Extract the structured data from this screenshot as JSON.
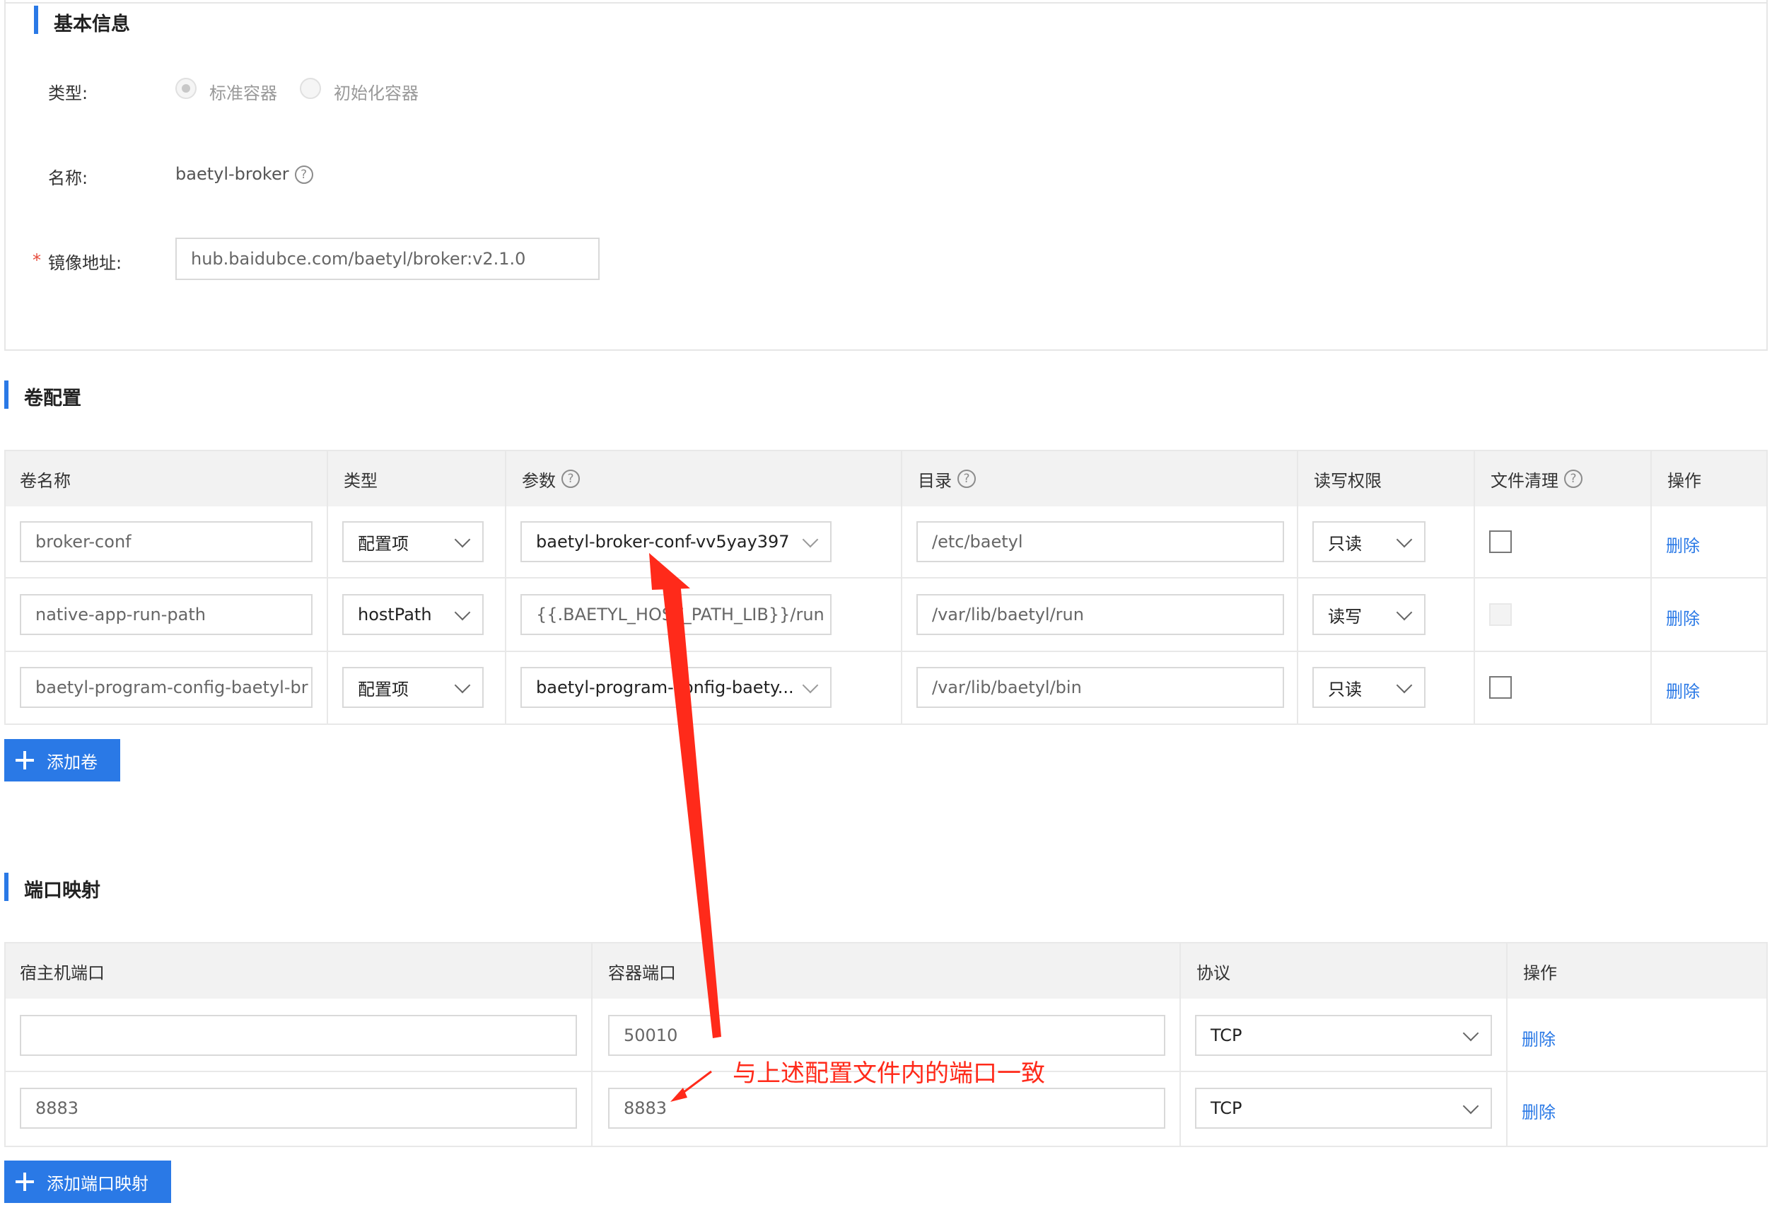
{
  "basic_info": {
    "title": "基本信息",
    "type_label": "类型:",
    "type_options": [
      "标准容器",
      "初始化容器"
    ],
    "name_label": "名称:",
    "name_value": "baetyl-broker",
    "image_label": "镜像地址:",
    "required_mark": "*",
    "image_value": "hub.baidubce.com/baetyl/broker:v2.1.0"
  },
  "volume_config": {
    "title": "卷配置",
    "columns": [
      "卷名称",
      "类型",
      "参数",
      "目录",
      "读写权限",
      "文件清理",
      "操作"
    ],
    "rows": [
      {
        "name": "broker-conf",
        "type": "配置项",
        "param": "baetyl-broker-conf-vv5yay397",
        "dir": "/etc/baetyl",
        "rw": "只读",
        "cleanup": "unchecked",
        "action": "删除"
      },
      {
        "name": "native-app-run-path",
        "type": "hostPath",
        "param": "{{.BAETYL_HOST_PATH_LIB}}/run",
        "dir": "/var/lib/baetyl/run",
        "rw": "读写",
        "cleanup": "disabled",
        "action": "删除"
      },
      {
        "name": "baetyl-program-config-baetyl-br",
        "type": "配置项",
        "param": "baetyl-program-config-baety...",
        "dir": "/var/lib/baetyl/bin",
        "rw": "只读",
        "cleanup": "unchecked",
        "action": "删除"
      }
    ],
    "add_button": "添加卷"
  },
  "port_mapping": {
    "title": "端口映射",
    "columns": [
      "宿主机端口",
      "容器端口",
      "协议",
      "操作"
    ],
    "rows": [
      {
        "host_port": "",
        "container_port": "50010",
        "protocol": "TCP",
        "action": "删除"
      },
      {
        "host_port": "8883",
        "container_port": "8883",
        "protocol": "TCP",
        "action": "删除"
      }
    ],
    "add_button": "添加端口映射"
  },
  "annotation": {
    "text": "与上述配置文件内的端口一致",
    "color": "#ff2a1a"
  },
  "colors": {
    "accent": "#2a79e6",
    "header_bg": "#f2f2f2",
    "border": "#e8e8e8"
  },
  "icons": [
    "question-circle-icon",
    "chevron-down-icon",
    "plus-icon",
    "red-arrow-annotation"
  ]
}
